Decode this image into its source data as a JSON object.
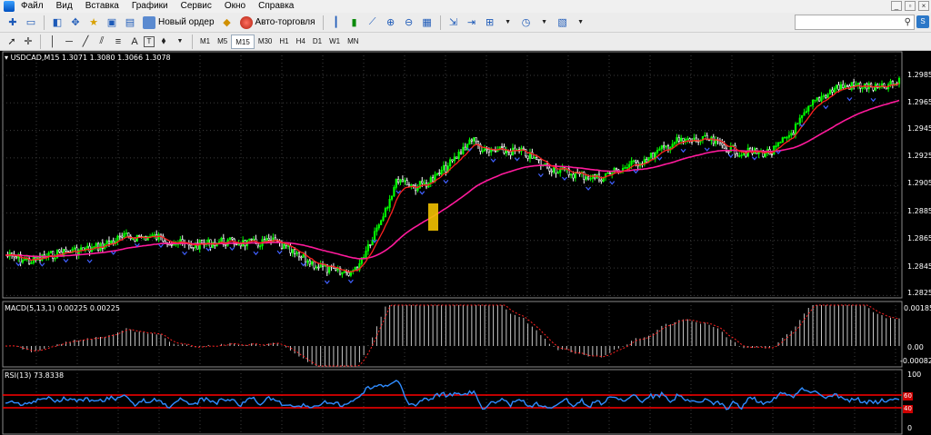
{
  "menu": {
    "items": [
      "Файл",
      "Вид",
      "Вставка",
      "Графики",
      "Сервис",
      "Окно",
      "Справка"
    ]
  },
  "toolbar": {
    "new_order_label": "Новый ордер",
    "auto_trading_label": "Авто-торговля"
  },
  "timeframes": [
    "M1",
    "M5",
    "M15",
    "M30",
    "H1",
    "H4",
    "D1",
    "W1",
    "MN"
  ],
  "active_timeframe": "M15",
  "chart": {
    "header": "USDCAD,M15  1.3071 1.3080 1.3066 1.3078",
    "price_ticks": [
      "1.2985",
      "1.2965",
      "1.2945",
      "1.2925",
      "1.2905",
      "1.2885",
      "1.2865",
      "1.2845",
      "1.2825"
    ],
    "macd_label": "MACD(5,13,1) 0.00225 0.00225",
    "macd_ticks": [
      "0.00185",
      "0.00",
      "-0.00082"
    ],
    "rsi_label": "RSI(13) 73.8338",
    "rsi_ticks": [
      "100",
      "0"
    ],
    "rsi_levels": [
      "60",
      "40"
    ]
  },
  "colors": {
    "bull": "#00ff00",
    "bear": "#ffffff",
    "ema_fast": "#ff2020",
    "ema_slow": "#ff1a9c",
    "arrow": "#4060ff",
    "macd": "#c8c8c8",
    "macd_signal": "#ff2020",
    "rsi": "#2f8cff",
    "rsi_level": "#ff0000"
  }
}
